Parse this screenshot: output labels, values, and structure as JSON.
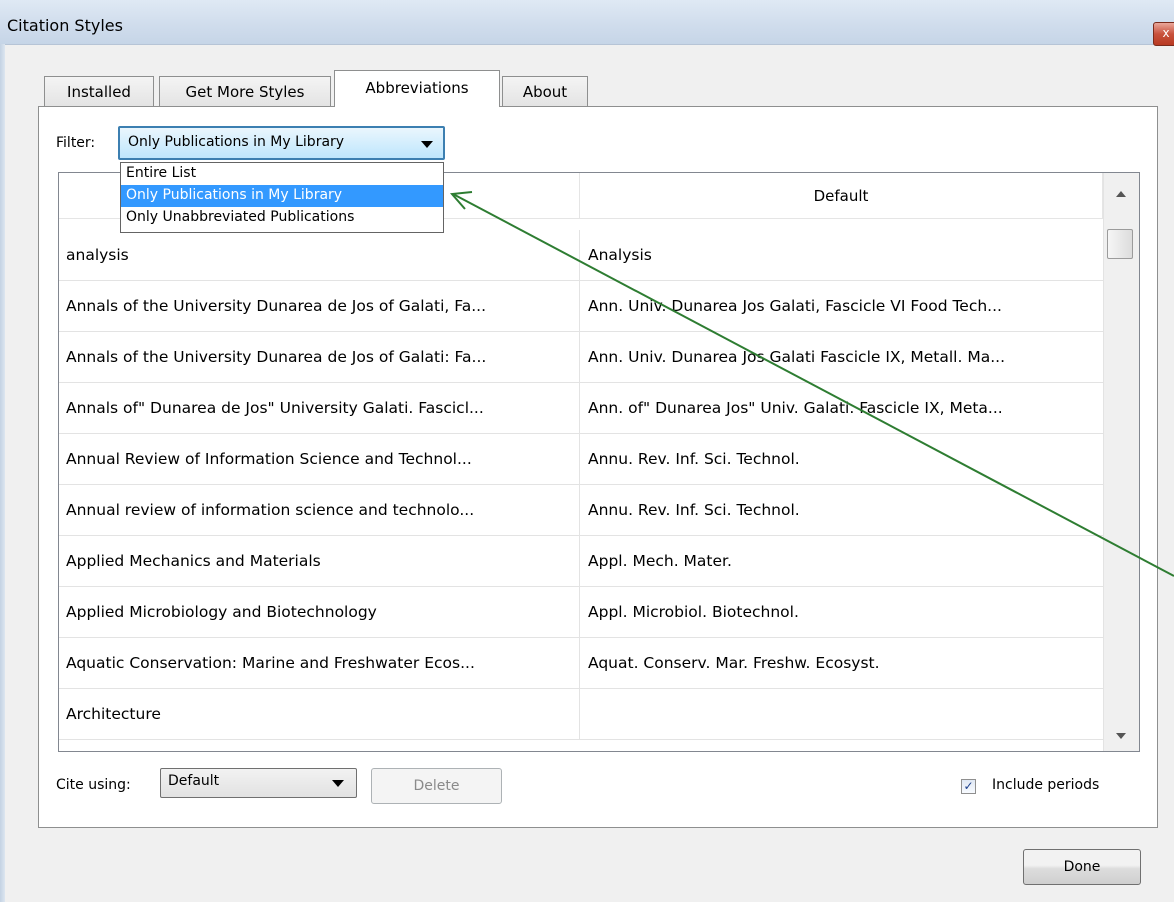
{
  "window": {
    "title": "Citation Styles",
    "close_glyph": "x"
  },
  "tabs": [
    {
      "label": "Installed"
    },
    {
      "label": "Get More Styles"
    },
    {
      "label": "Abbreviations"
    },
    {
      "label": "About"
    }
  ],
  "active_tab": "Abbreviations",
  "filter": {
    "label": "Filter:",
    "selected": "Only Publications in My Library",
    "options": [
      "Entire List",
      "Only Publications in My Library",
      "Only Unabbreviated Publications"
    ]
  },
  "table": {
    "columns": [
      "",
      "Default"
    ],
    "rows": [
      {
        "name": "analysis",
        "abbr": "Analysis"
      },
      {
        "name": "Annals of the University Dunarea de Jos of Galati, Fa...",
        "abbr": "Ann. Univ. Dunarea Jos Galati, Fascicle VI Food Tech..."
      },
      {
        "name": "Annals of the University Dunarea de Jos of Galati: Fa...",
        "abbr": "Ann. Univ. Dunarea Jos Galati Fascicle IX, Metall. Ma..."
      },
      {
        "name": "Annals of\" Dunarea de Jos\" University Galati. Fascicl...",
        "abbr": "Ann. of\" Dunarea Jos\" Univ. Galati. Fascicle IX, Meta..."
      },
      {
        "name": "Annual Review of Information Science and Technol...",
        "abbr": "Annu. Rev. Inf. Sci. Technol."
      },
      {
        "name": "Annual review of information science and technolo...",
        "abbr": "Annu. Rev. Inf. Sci. Technol."
      },
      {
        "name": "Applied Mechanics and Materials",
        "abbr": "Appl. Mech. Mater."
      },
      {
        "name": "Applied Microbiology and Biotechnology",
        "abbr": "Appl. Microbiol. Biotechnol."
      },
      {
        "name": "Aquatic Conservation: Marine and Freshwater Ecos...",
        "abbr": "Aquat. Conserv. Mar. Freshw. Ecosyst."
      },
      {
        "name": "Architecture",
        "abbr": ""
      }
    ]
  },
  "cite_using": {
    "label": "Cite using:",
    "selected": "Default"
  },
  "delete_button": {
    "label": "Delete"
  },
  "include_periods": {
    "label": "Include periods",
    "checked": true,
    "check_glyph": "✓"
  },
  "done_button": {
    "label": "Done"
  },
  "colors": {
    "annotation_arrow": "#2e7d32",
    "selection": "#3399ff",
    "focus_border": "#3c7fb1"
  },
  "icons": [
    "close-icon",
    "dropdown-arrow-icon",
    "scroll-up-icon",
    "scroll-down-icon",
    "checkbox-check-icon",
    "annotation-arrow"
  ]
}
